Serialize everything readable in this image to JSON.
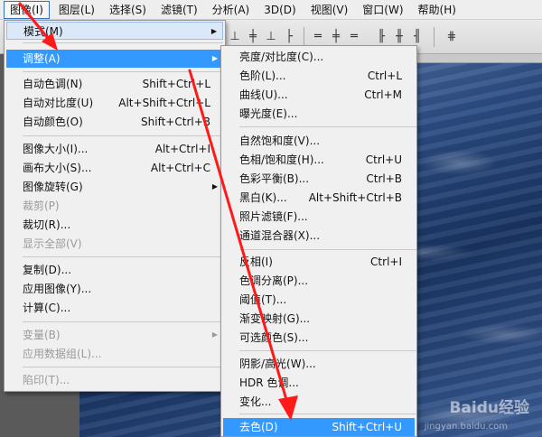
{
  "menubar": {
    "items": [
      {
        "label": "图像(I)",
        "active": true
      },
      {
        "label": "图层(L)"
      },
      {
        "label": "选择(S)"
      },
      {
        "label": "滤镜(T)"
      },
      {
        "label": "分析(A)"
      },
      {
        "label": "3D(D)"
      },
      {
        "label": "视图(V)"
      },
      {
        "label": "窗口(W)"
      },
      {
        "label": "帮助(H)"
      }
    ]
  },
  "image_menu": {
    "items": [
      {
        "label": "模式(M)",
        "submenu": true
      },
      {
        "label": "调整(A)",
        "submenu": true,
        "highlighted": true
      },
      {
        "label": "自动色调(N)",
        "shortcut": "Shift+Ctrl+L"
      },
      {
        "label": "自动对比度(U)",
        "shortcut": "Alt+Shift+Ctrl+L"
      },
      {
        "label": "自动颜色(O)",
        "shortcut": "Shift+Ctrl+B"
      },
      {
        "label": "图像大小(I)...",
        "shortcut": "Alt+Ctrl+I"
      },
      {
        "label": "画布大小(S)...",
        "shortcut": "Alt+Ctrl+C"
      },
      {
        "label": "图像旋转(G)",
        "submenu": true
      },
      {
        "label": "裁剪(P)",
        "disabled": true
      },
      {
        "label": "裁切(R)..."
      },
      {
        "label": "显示全部(V)",
        "disabled": true
      },
      {
        "label": "复制(D)..."
      },
      {
        "label": "应用图像(Y)..."
      },
      {
        "label": "计算(C)..."
      },
      {
        "label": "变量(B)",
        "submenu": true,
        "disabled": true
      },
      {
        "label": "应用数据组(L)...",
        "disabled": true
      },
      {
        "label": "陷印(T)...",
        "disabled": true
      }
    ]
  },
  "adjust_submenu": {
    "items": [
      {
        "label": "亮度/对比度(C)..."
      },
      {
        "label": "色阶(L)...",
        "shortcut": "Ctrl+L"
      },
      {
        "label": "曲线(U)...",
        "shortcut": "Ctrl+M"
      },
      {
        "label": "曝光度(E)..."
      },
      {
        "label": "自然饱和度(V)..."
      },
      {
        "label": "色相/饱和度(H)...",
        "shortcut": "Ctrl+U"
      },
      {
        "label": "色彩平衡(B)...",
        "shortcut": "Ctrl+B"
      },
      {
        "label": "黑白(K)...",
        "shortcut": "Alt+Shift+Ctrl+B"
      },
      {
        "label": "照片滤镜(F)..."
      },
      {
        "label": "通道混合器(X)..."
      },
      {
        "label": "反相(I)",
        "shortcut": "Ctrl+I"
      },
      {
        "label": "色调分离(P)..."
      },
      {
        "label": "阈值(T)..."
      },
      {
        "label": "渐变映射(G)..."
      },
      {
        "label": "可选颜色(S)..."
      },
      {
        "label": "阴影/高光(W)..."
      },
      {
        "label": "HDR 色调..."
      },
      {
        "label": "变化..."
      },
      {
        "label": "去色(D)",
        "shortcut": "Shift+Ctrl+U",
        "highlighted": true
      }
    ]
  },
  "watermark": {
    "text": "Baidu经验",
    "url": "jingyan.baidu.com"
  },
  "colors": {
    "menu_highlight": "#3399ff",
    "annotation_arrow": "#ff1a1a"
  }
}
